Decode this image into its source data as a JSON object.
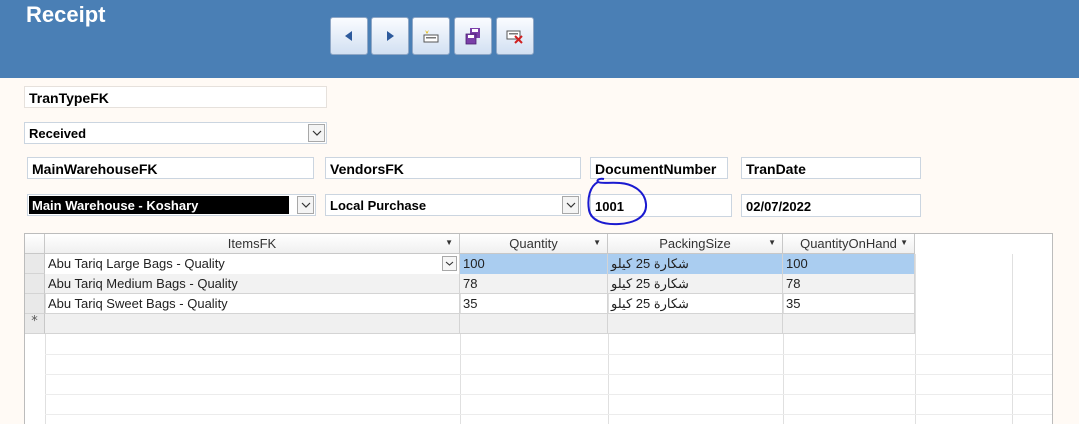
{
  "window": {
    "title": "Receipt"
  },
  "toolbar": [
    {
      "name": "previous-record-button",
      "icon": "triangle-left-icon"
    },
    {
      "name": "next-record-button",
      "icon": "triangle-right-icon"
    },
    {
      "name": "new-record-button",
      "icon": "new-record-icon"
    },
    {
      "name": "save-record-button",
      "icon": "save-icon"
    },
    {
      "name": "delete-record-button",
      "icon": "delete-icon"
    }
  ],
  "form": {
    "tran_type_label": "TranTypeFK",
    "tran_type_value": "Received",
    "main_warehouse_label": "MainWarehouseFK",
    "main_warehouse_value": "Main Warehouse - Koshary",
    "vendors_label": "VendorsFK",
    "vendors_value": "Local Purchase",
    "document_number_label": "DocumentNumber",
    "document_number_value": "1001",
    "tran_date_label": "TranDate",
    "tran_date_value": "02/07/2022"
  },
  "annotation": {
    "color": "#1a1ad0",
    "shape": "hand-drawn-circle"
  },
  "grid": {
    "columns": [
      "ItemsFK",
      "Quantity",
      "PackingSize",
      "QuantityOnHand"
    ],
    "rows": [
      [
        "Abu Tariq Large Bags - Quality",
        "100",
        "شكارة 25 كيلو",
        "100"
      ],
      [
        "Abu Tariq Medium Bags - Quality",
        "78",
        "شكارة 25 كيلو",
        "78"
      ],
      [
        "Abu Tariq Sweet Bags - Quality",
        "35",
        "شكارة 25 كيلو",
        "35"
      ]
    ],
    "new_row_marker": "*"
  },
  "colors": {
    "header": "#4a7fb5",
    "selection": "#aacdf0",
    "background": "#fffaf5"
  }
}
